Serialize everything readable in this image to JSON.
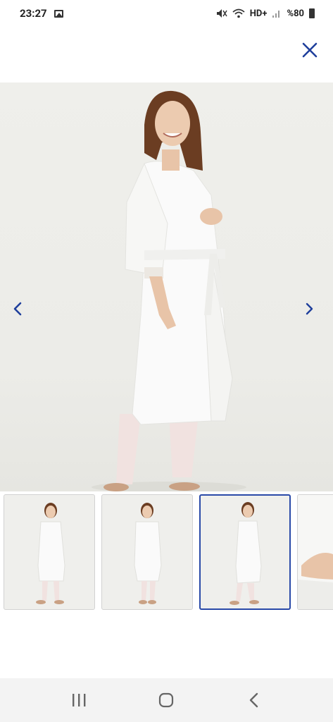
{
  "status_bar": {
    "time": "23:27",
    "network": "HD+",
    "battery": "%80"
  },
  "header": {
    "close_icon": "close-icon"
  },
  "gallery": {
    "prev_icon": "chevron-left-icon",
    "next_icon": "chevron-right-icon",
    "selected_index": 2,
    "image_count_visible": 4
  },
  "thumbnails": [
    {
      "name": "thumb-1",
      "active": false
    },
    {
      "name": "thumb-2",
      "active": false
    },
    {
      "name": "thumb-3",
      "active": true
    },
    {
      "name": "thumb-4",
      "active": false
    }
  ],
  "system_nav": {
    "recents_icon": "recents-icon",
    "home_icon": "home-icon",
    "back_icon": "back-icon"
  },
  "colors": {
    "accent": "#2a4aa8",
    "close": "#1f3f9c"
  }
}
